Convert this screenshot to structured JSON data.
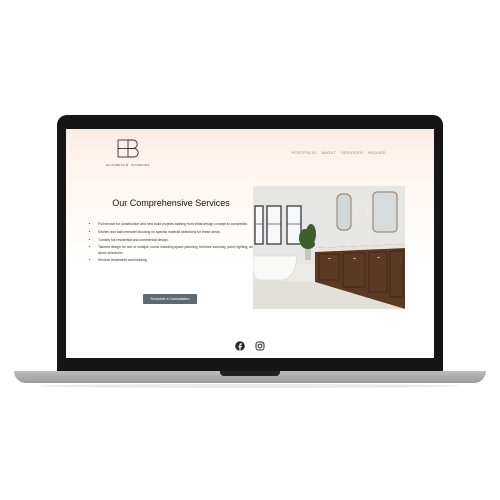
{
  "site": {
    "brand_name": "ELIZABETH B. INTERIORS",
    "nav": [
      "PORTFOLIO",
      "ABOUT",
      "SERVICES",
      "INQUIRE"
    ],
    "heading": "Our Comprehensive Services",
    "bullets": [
      "Full service for construction and new build projects starting from initial design concept to completion.",
      "Kitchen and bath remodel focusing on specific material selections for these areas.",
      "Turnkey full residential and commercial design.",
      "Tailored design for one or multiple rooms including space planning, furniture sourcing, paint, lighting, and decor selections.",
      "Window treatments and bedding."
    ],
    "cta_label": "Schedule a Consultation",
    "social": [
      "facebook-icon",
      "instagram-icon"
    ]
  },
  "colors": {
    "screen_gradient_top": "#fbece2",
    "button": "#5f6770",
    "bezel": "#151515",
    "laptop_base": "#a8a8a8"
  }
}
